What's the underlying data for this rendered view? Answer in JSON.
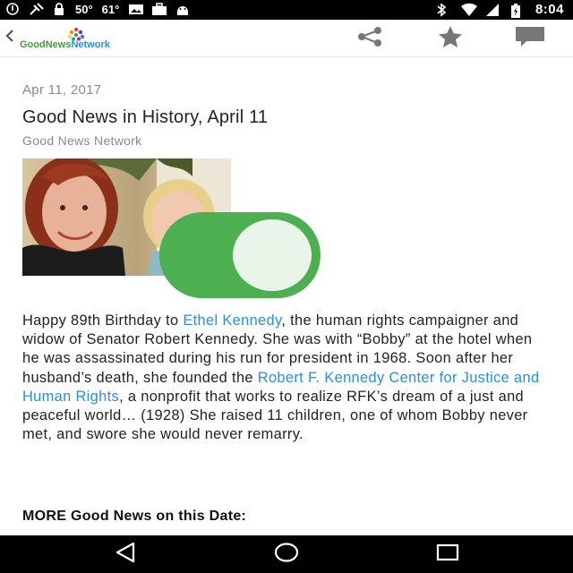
{
  "status_bar": {
    "temp1": "50°",
    "temp2": "61°",
    "time": "8:04",
    "icons": [
      "circle-icon",
      "satellite-icon",
      "lock-icon",
      "photo-icon",
      "briefcase-icon",
      "android-icon",
      "bluetooth-icon",
      "wifi-icon",
      "signal-icon",
      "battery-icon"
    ]
  },
  "app_bar": {
    "logo_part1": "GoodNews",
    "logo_part2": "Network",
    "icons": [
      "back-arrow-icon",
      "share-icon",
      "star-icon",
      "comment-icon"
    ]
  },
  "article": {
    "date": "Apr 11, 2017",
    "title": "Good News in History, April 11",
    "source": "Good News Network",
    "p1": "Happy 89th Birthday to ",
    "link1": "Ethel Kennedy",
    "p2": ", the human rights campaigner and widow of Senator Robert Kennedy. She was with “Bobby” at the hotel when he was assassinated during his run for president in 1968. Soon after her husband’s death, she founded the ",
    "link2": "Robert F. Kennedy Center for Justice and Human Rights",
    "p3": ", a nonprofit that works to realize RFK’s dream of a just and peaceful world… (1928) She raised 11 children, one of whom Bobby never met, and swore she would never remarry.",
    "more_heading": "MORE Good News on this Date:"
  },
  "toggle": {
    "state": "on"
  },
  "colors": {
    "link": "#2b8fd0",
    "toggle_on": "#4caf50",
    "logo_green": "#3aa03a",
    "meta_gray": "#8a8a8a"
  },
  "nav_bar": {
    "icons": [
      "nav-back-icon",
      "nav-home-icon",
      "nav-recents-icon"
    ]
  }
}
